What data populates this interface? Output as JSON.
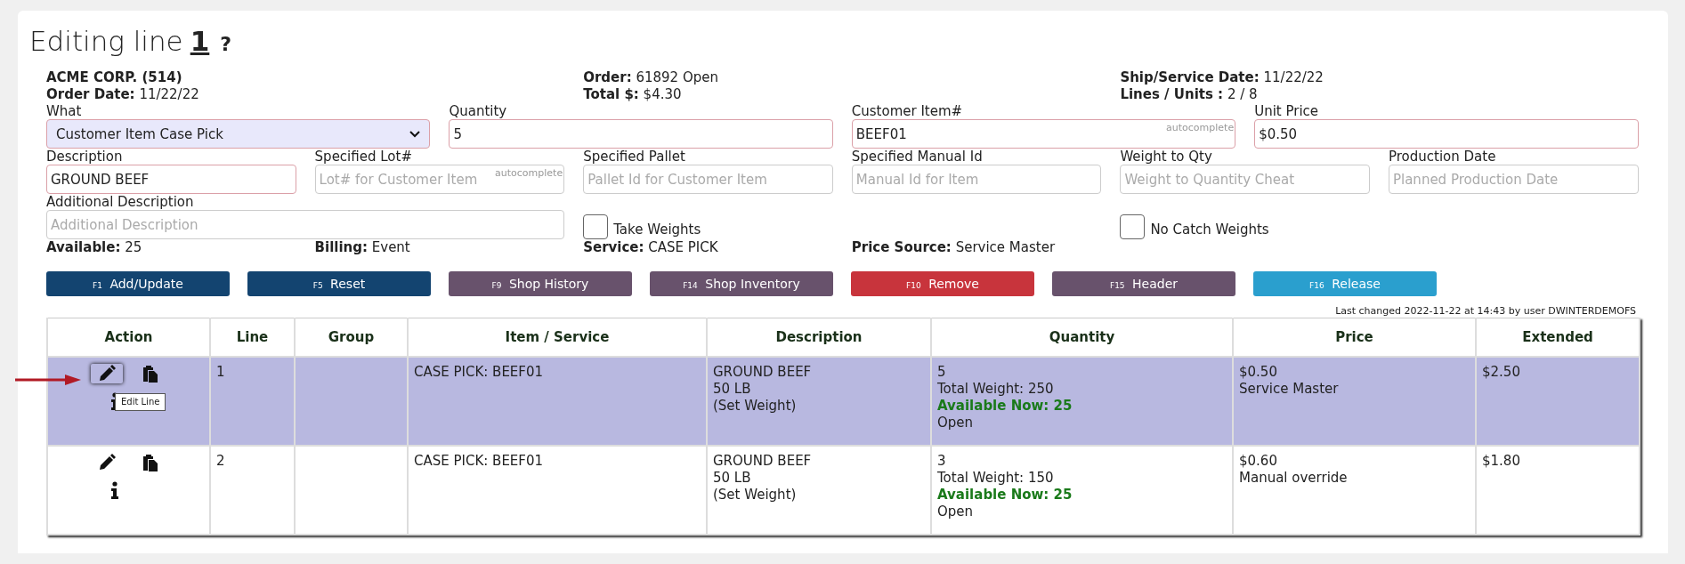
{
  "page": {
    "title": "Editing line",
    "line_number": "1",
    "help": "?"
  },
  "header": [
    [
      {
        "label": "ACME CORP. (514)"
      },
      {
        "label": "Order Date:",
        "value": "11/22/22"
      }
    ],
    [
      {
        "label": "Order:",
        "value": "61892 Open"
      },
      {
        "label": "Total $:",
        "value": "$4.30"
      }
    ],
    [
      {
        "label": "Ship/Service Date:",
        "value": "11/22/22"
      },
      {
        "label": "Lines / Units :",
        "value": "2 / 8"
      }
    ]
  ],
  "form_rows": [
    [
      {
        "kind": "select",
        "label": "What",
        "value": "Customer Item Case Pick",
        "required": true
      },
      {
        "kind": "text",
        "label": "Quantity",
        "value": "5",
        "required": true
      },
      {
        "kind": "text",
        "label": "Customer Item#",
        "value": "BEEF01",
        "hint": "autocomplete",
        "required": true
      },
      {
        "kind": "text",
        "label": "Unit Price",
        "value": "$0.50",
        "required": true
      }
    ],
    [
      {
        "kind": "text",
        "label": "Description",
        "value": "GROUND BEEF",
        "required": true
      },
      {
        "kind": "text",
        "label": "Specified Lot#",
        "placeholder": "Lot# for Customer Item",
        "hint": "autocomplete",
        "required": false
      },
      {
        "kind": "text",
        "label": "Specified Pallet",
        "placeholder": "Pallet Id for Customer Item",
        "required": false
      },
      {
        "kind": "text",
        "label": "Specified Manual Id",
        "placeholder": "Manual Id for Item",
        "required": false
      },
      {
        "kind": "text",
        "label": "Weight to Qty",
        "placeholder": "Weight to Quantity Cheat",
        "required": false
      },
      {
        "kind": "text",
        "label": "Production Date",
        "placeholder": "Planned Production Date",
        "required": false
      }
    ],
    [
      {
        "kind": "text",
        "label": "Additional Description",
        "placeholder": "Additional Description",
        "required": false
      },
      {
        "kind": "checkbox",
        "label": "Take Weights",
        "checked": false
      },
      {
        "kind": "checkbox",
        "label": "No Catch Weights",
        "checked": false
      }
    ]
  ],
  "info": [
    {
      "label": "Available:",
      "value": "25"
    },
    {
      "label": "Billing:",
      "value": "Event"
    },
    {
      "label": "Service:",
      "value": "CASE PICK"
    },
    {
      "label": "Price Source:",
      "value": "Service Master"
    }
  ],
  "buttons": [
    {
      "key": "F1",
      "label": "Add/Update",
      "color": "#134470"
    },
    {
      "key": "F5",
      "label": "Reset",
      "color": "#134470"
    },
    {
      "key": "F9",
      "label": "Shop History",
      "color": "#68526c"
    },
    {
      "key": "F14",
      "label": "Shop Inventory",
      "color": "#68526c"
    },
    {
      "key": "F10",
      "label": "Remove",
      "color": "#c8343c"
    },
    {
      "key": "F15",
      "label": "Header",
      "color": "#68526c"
    },
    {
      "key": "F16",
      "label": "Release",
      "color": "#2a9fce"
    }
  ],
  "last_changed": "Last changed 2022-11-22 at 14:43 by user DWINTERDEMOFS",
  "table": {
    "columns": [
      "Action",
      "Line",
      "Group",
      "Item / Service",
      "Description",
      "Quantity",
      "Price",
      "Extended"
    ],
    "rows": [
      {
        "selected": true,
        "tooltip": "Edit Line",
        "line": "1",
        "item": "CASE PICK: BEEF01",
        "description": [
          "GROUND BEEF",
          "50 LB",
          "(Set Weight)"
        ],
        "quantity": "5",
        "total_weight": "Total Weight: 250",
        "available": "Available Now: 25",
        "status": "Open",
        "price": "$0.50",
        "price_source": "Service Master",
        "extended": "$2.50"
      },
      {
        "selected": false,
        "line": "2",
        "item": "CASE PICK: BEEF01",
        "description": [
          "GROUND BEEF",
          "50 LB",
          "(Set Weight)"
        ],
        "quantity": "3",
        "total_weight": "Total Weight: 150",
        "available": "Available Now: 25",
        "status": "Open",
        "price": "$0.60",
        "price_source": "Manual override",
        "extended": "$1.80"
      }
    ]
  }
}
